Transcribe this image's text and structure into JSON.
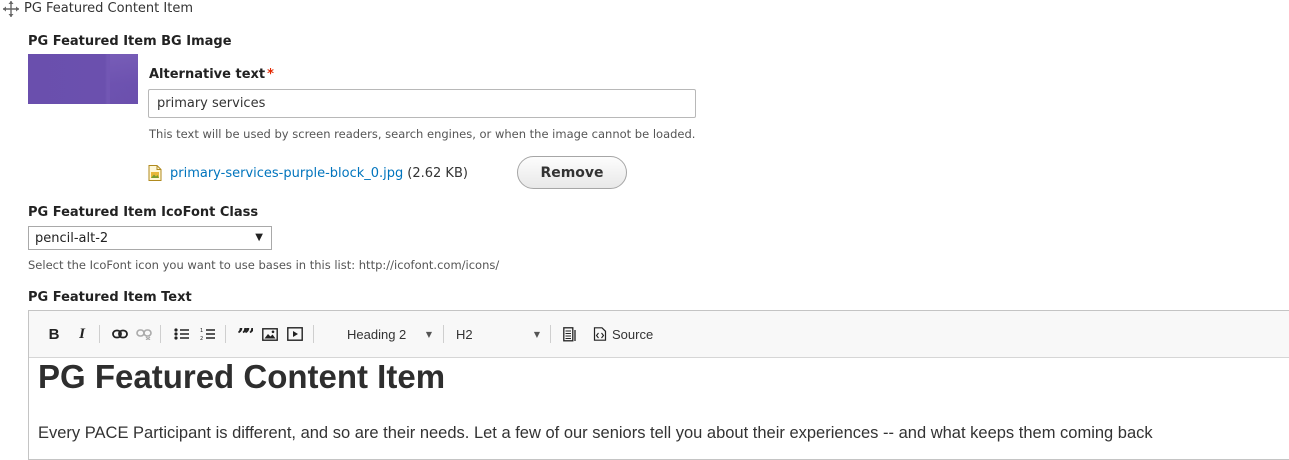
{
  "paragraph": {
    "title": "PG Featured Content Item"
  },
  "bg_image": {
    "label": "PG Featured Item BG Image",
    "thumbnail_color": "#6a4fad",
    "alt_label": "Alternative text",
    "required_marker": "*",
    "alt_value": "primary services",
    "alt_help": "This text will be used by screen readers, search engines, or when the image cannot be loaded.",
    "file_name": "primary-services-purple-block_0.jpg",
    "file_size": "(2.62 KB)",
    "remove_label": "Remove"
  },
  "icofont": {
    "label": "PG Featured Item IcoFont Class",
    "selected": "pencil-alt-2",
    "help": "Select the IcoFont icon you want to use bases in this list: http://icofont.com/icons/"
  },
  "text_field": {
    "label": "PG Featured Item Text",
    "toolbar": {
      "bold": "B",
      "italic": "I",
      "format_combo": "Heading 2",
      "style_combo": "H2",
      "source_label": "Source"
    },
    "content": {
      "heading": "PG Featured Content Item",
      "paragraph": "Every PACE Participant is different, and so are their needs.  Let a few of our seniors tell you about their experiences -- and what keeps them coming back"
    }
  },
  "colors": {
    "link": "#0074bd",
    "required": "#e32700"
  }
}
